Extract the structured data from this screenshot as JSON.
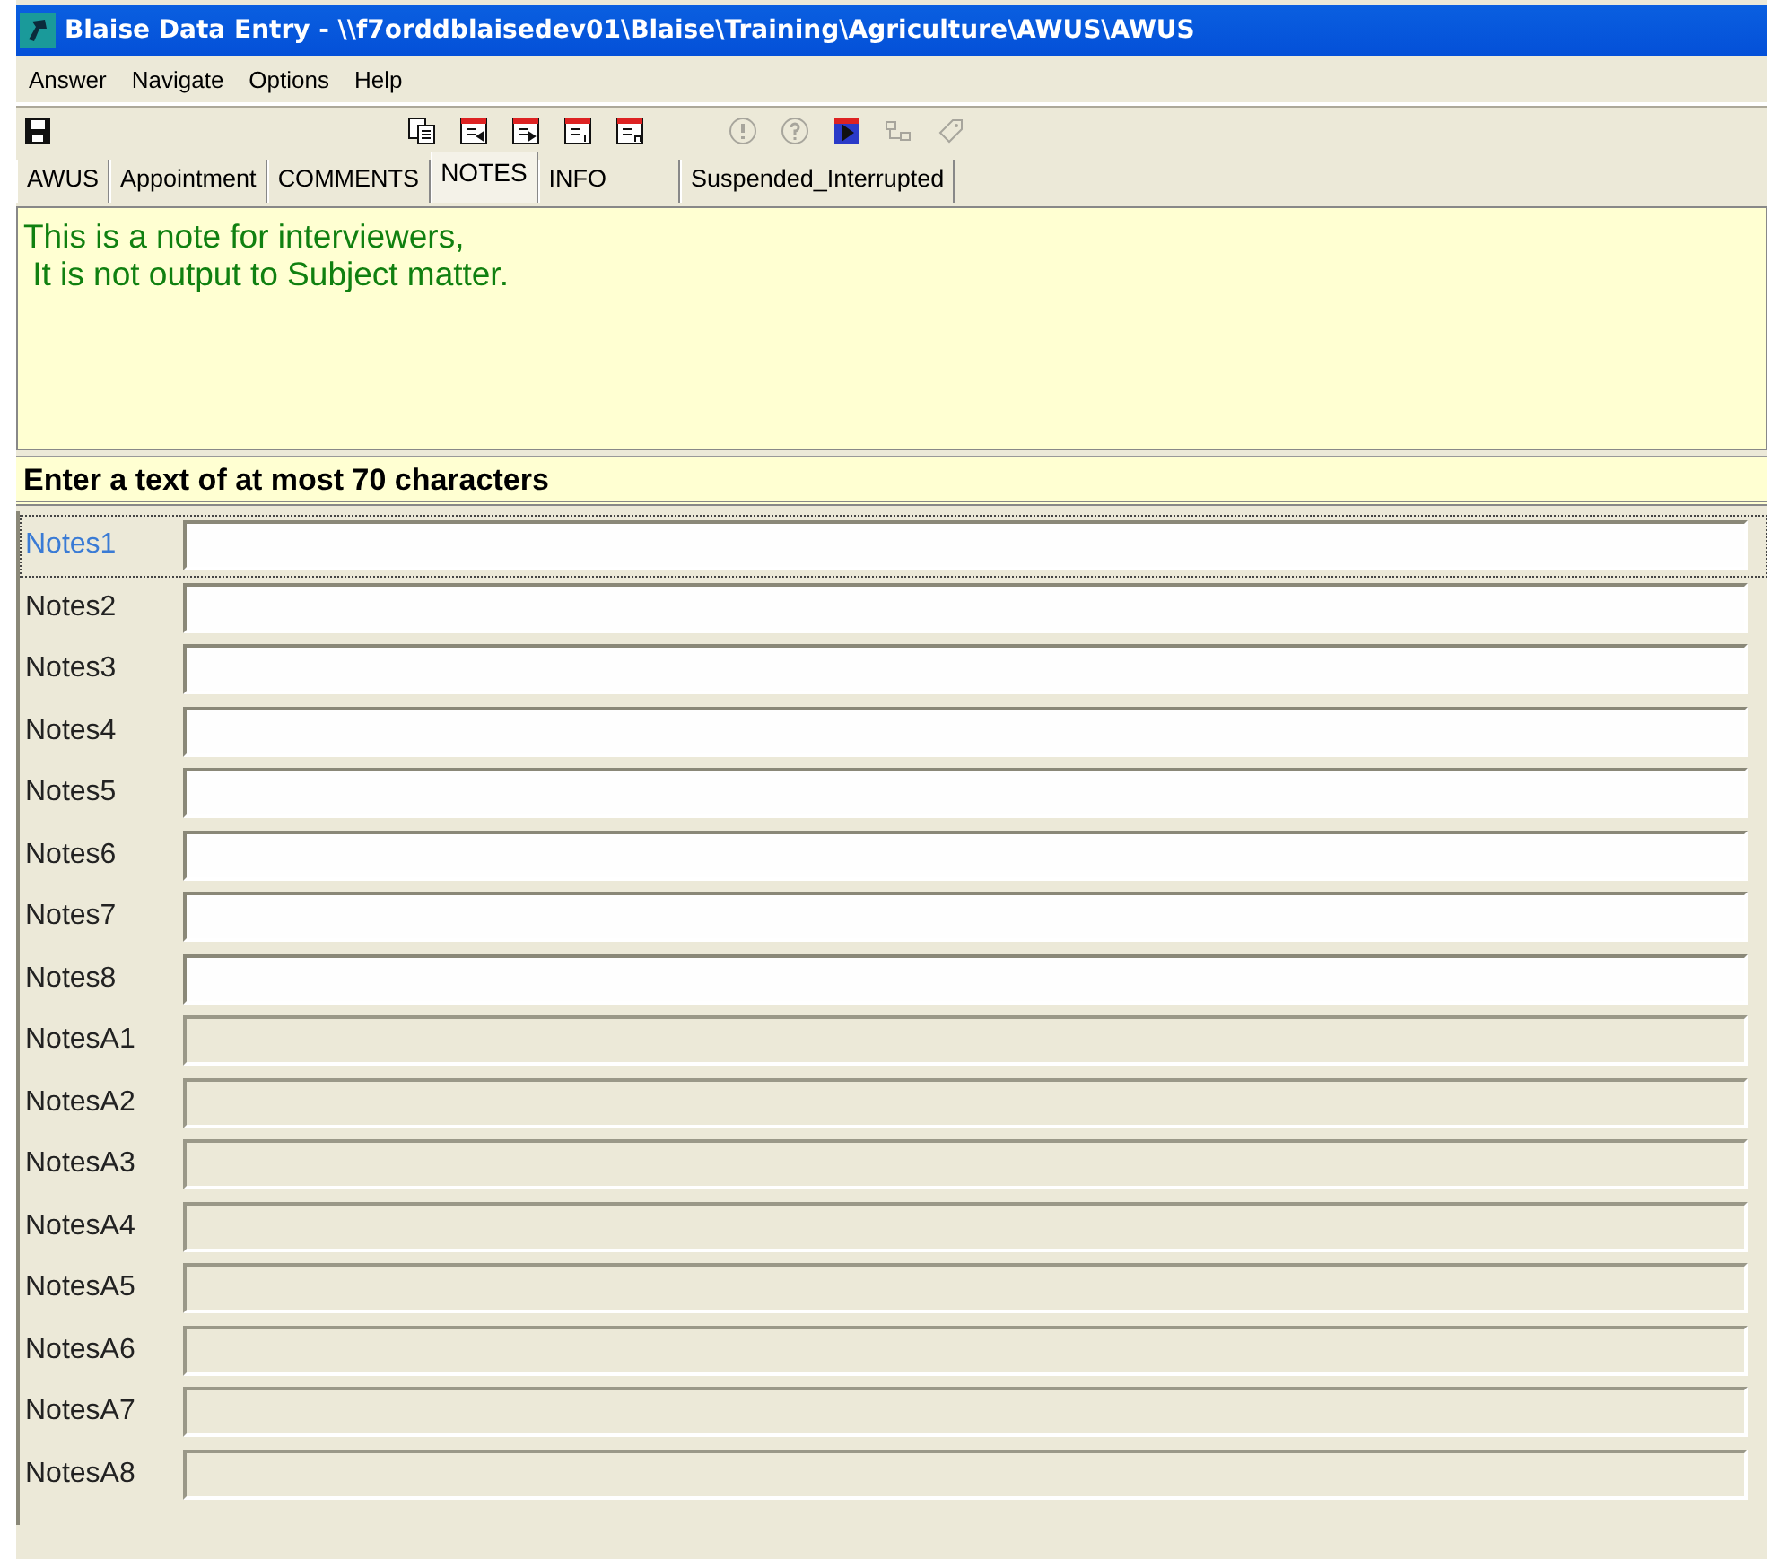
{
  "window": {
    "title": "Blaise Data Entry - \\\\f7orddblaisedev01\\Blaise\\Training\\Agriculture\\AWUS\\AWUS"
  },
  "menu": [
    "Answer",
    "Navigate",
    "Options",
    "Help"
  ],
  "toolbar": [
    {
      "items": [
        {
          "kind": "save",
          "disabled": false
        }
      ]
    },
    {
      "items": [
        {
          "kind": "copy",
          "disabled": false
        },
        {
          "kind": "prev",
          "disabled": false
        },
        {
          "kind": "next",
          "disabled": false
        },
        {
          "kind": "first",
          "disabled": false
        },
        {
          "kind": "last",
          "disabled": false
        }
      ]
    },
    {
      "items": [
        {
          "kind": "error",
          "disabled": true
        },
        {
          "kind": "help",
          "disabled": true
        },
        {
          "kind": "play",
          "disabled": false
        },
        {
          "kind": "tree",
          "disabled": true
        },
        {
          "kind": "tag",
          "disabled": true
        }
      ]
    }
  ],
  "tabs": [
    {
      "label": "AWUS",
      "selected": false
    },
    {
      "label": "Appointment",
      "selected": false
    },
    {
      "label": "COMMENTS",
      "selected": false
    },
    {
      "label": "NOTES",
      "selected": true
    },
    {
      "label": "INFO",
      "selected": false
    },
    {
      "label": "Suspended_Interrupted",
      "selected": false
    }
  ],
  "note": {
    "lines": [
      "This is a note for interviewers,",
      " It is not output to Subject matter."
    ]
  },
  "prompt": "Enter a text of at most 70 characters",
  "fields": [
    {
      "label": "Notes1",
      "selected": true,
      "disabled": false
    },
    {
      "label": "Notes2",
      "selected": false,
      "disabled": false
    },
    {
      "label": "Notes3",
      "selected": false,
      "disabled": false
    },
    {
      "label": "Notes4",
      "selected": false,
      "disabled": false
    },
    {
      "label": "Notes5",
      "selected": false,
      "disabled": false
    },
    {
      "label": "Notes6",
      "selected": false,
      "disabled": false
    },
    {
      "label": "Notes7",
      "selected": false,
      "disabled": false
    },
    {
      "label": "Notes8",
      "selected": false,
      "disabled": false
    },
    {
      "label": "NotesA1",
      "selected": false,
      "disabled": true
    },
    {
      "label": "NotesA2",
      "selected": false,
      "disabled": true
    },
    {
      "label": "NotesA3",
      "selected": false,
      "disabled": true
    },
    {
      "label": "NotesA4",
      "selected": false,
      "disabled": true
    },
    {
      "label": "NotesA5",
      "selected": false,
      "disabled": true
    },
    {
      "label": "NotesA6",
      "selected": false,
      "disabled": true
    },
    {
      "label": "NotesA7",
      "selected": false,
      "disabled": true
    },
    {
      "label": "NotesA8",
      "selected": false,
      "disabled": true
    }
  ]
}
